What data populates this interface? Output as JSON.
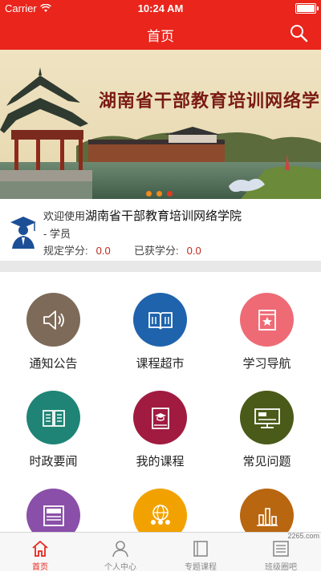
{
  "status_bar": {
    "carrier": "Carrier",
    "time": "10:24 AM",
    "battery_level": 1.0
  },
  "nav": {
    "title": "首页",
    "search_icon": "search-icon"
  },
  "banner": {
    "title": "湖南省干部教育培训网络学院",
    "slide_count": 3,
    "active_slide": 2
  },
  "welcome": {
    "greeting": "欢迎使用",
    "institution": "湖南省干部教育培训网络学院",
    "role": "- 学员",
    "required_credits_label": "规定学分:",
    "required_credits_value": "0.0",
    "earned_credits_label": "已获学分:",
    "earned_credits_value": "0.0"
  },
  "grid": [
    {
      "label": "通知公告",
      "icon": "speaker-icon",
      "color": "#7d6a58"
    },
    {
      "label": "课程超市",
      "icon": "open-book-icon",
      "color": "#1f63ad"
    },
    {
      "label": "学习导航",
      "icon": "bookmark-star-icon",
      "color": "#ee6b75"
    },
    {
      "label": "时政要闻",
      "icon": "newspaper-icon",
      "color": "#1f8475"
    },
    {
      "label": "我的课程",
      "icon": "graduation-book-icon",
      "color": "#a11b40"
    },
    {
      "label": "常见问题",
      "icon": "monitor-icon",
      "color": "#4a5a18"
    },
    {
      "label": "",
      "icon": "news-icon",
      "color": "#8a4fa8"
    },
    {
      "label": "",
      "icon": "globe-people-icon",
      "color": "#f2a200"
    },
    {
      "label": "",
      "icon": "bar-chart-icon",
      "color": "#b8660f"
    }
  ],
  "tabbar": [
    {
      "label": "首页",
      "icon": "home-icon",
      "active": true
    },
    {
      "label": "个人中心",
      "icon": "person-icon",
      "active": false
    },
    {
      "label": "专题课程",
      "icon": "book-icon",
      "active": false
    },
    {
      "label": "班级圈吧",
      "icon": "list-icon",
      "active": false
    }
  ],
  "watermark": "2265.com"
}
